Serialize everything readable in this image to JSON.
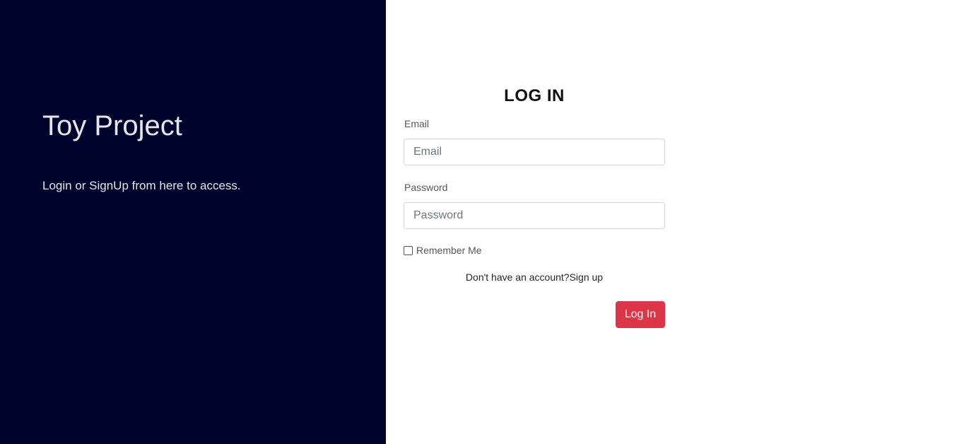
{
  "brand": {
    "title": "Toy Project",
    "subtitle": "Login or SignUp from here to access."
  },
  "form": {
    "title": "LOG IN",
    "email_label": "Email",
    "email_placeholder": "Email",
    "email_value": "",
    "password_label": "Password",
    "password_placeholder": "Password",
    "password_value": "",
    "remember_label": "Remember Me",
    "remember_checked": false,
    "no_account_text": "Don't have an account?",
    "signup_link": "Sign up",
    "login_button": "Log In"
  },
  "colors": {
    "left_panel_bg": "#00032b",
    "button_bg": "#dc3545"
  }
}
